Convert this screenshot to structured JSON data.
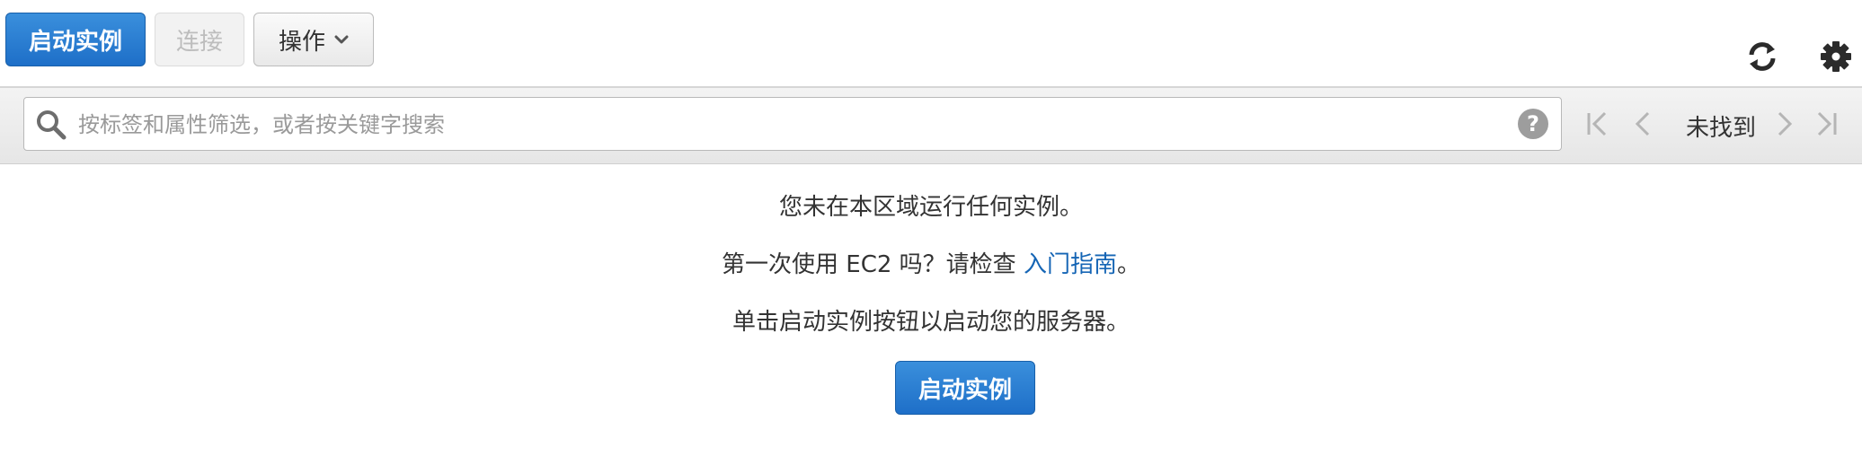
{
  "toolbar": {
    "launch_label": "启动实例",
    "connect_label": "连接",
    "actions_label": "操作",
    "actions_icon": "chevron-down-icon",
    "refresh_icon": "refresh-icon",
    "settings_icon": "gear-icon"
  },
  "filter": {
    "placeholder": "按标签和属性筛选，或者按关键字搜索",
    "help_symbol": "?"
  },
  "pagination": {
    "status": "未找到"
  },
  "empty_state": {
    "line1": "您未在本区域运行任何实例。",
    "line2_prefix": "第一次使用 EC2 吗？请检查 ",
    "line2_link": "入门指南",
    "line2_suffix": "。",
    "line3": "单击启动实例按钮以启动您的服务器。",
    "launch_label": "启动实例"
  },
  "colors": {
    "primary": "#1e6fc8",
    "link": "#1565b5",
    "disabled_text": "#bdbdbd"
  }
}
